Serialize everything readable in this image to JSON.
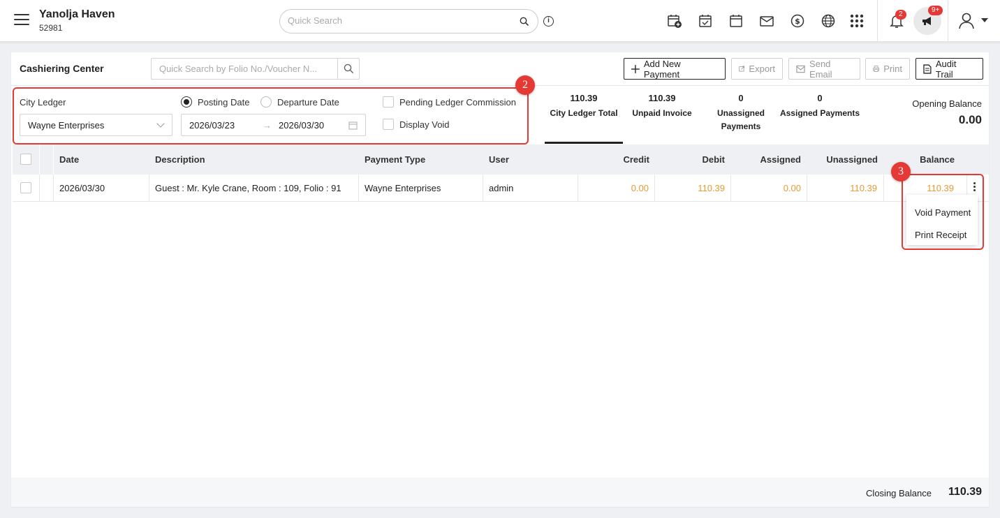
{
  "header": {
    "hotel_name": "Yanolja Haven",
    "hotel_code": "52981",
    "search_placeholder": "Quick Search",
    "notification_count": "2",
    "announcement_count": "9+"
  },
  "page": {
    "title": "Cashiering Center",
    "folio_search_placeholder": "Quick Search by Folio No./Voucher N...",
    "buttons": {
      "add_payment": "Add New Payment",
      "export": "Export",
      "send_email": "Send Email",
      "print": "Print",
      "audit_trail": "Audit Trail"
    }
  },
  "filters": {
    "ledger_label": "City Ledger",
    "ledger_value": "Wayne Enterprises",
    "posting_date_label": "Posting Date",
    "departure_date_label": "Departure Date",
    "date_from": "2026/03/23",
    "date_arrow": "→",
    "date_to": "2026/03/30",
    "pending_commission_label": "Pending Ledger Commission",
    "display_void_label": "Display Void",
    "posting_selected": true
  },
  "summary": {
    "city_ledger_total_value": "110.39",
    "city_ledger_total_label": "City Ledger Total",
    "unpaid_invoice_value": "110.39",
    "unpaid_invoice_label": "Unpaid Invoice",
    "unassigned_value": "0",
    "unassigned_label_1": "Unassigned",
    "unassigned_label_2": "Payments",
    "assigned_value": "0",
    "assigned_label": "Assigned Payments",
    "opening_balance_label": "Opening Balance",
    "opening_balance_value": "0.00"
  },
  "table": {
    "columns": {
      "date": "Date",
      "description": "Description",
      "payment_type": "Payment Type",
      "user": "User",
      "credit": "Credit",
      "debit": "Debit",
      "assigned": "Assigned",
      "unassigned": "Unassigned",
      "balance": "Balance"
    },
    "rows": [
      {
        "date": "2026/03/30",
        "description": "Guest : Mr. Kyle Crane, Room : 109, Folio : 91",
        "payment_type": "Wayne Enterprises",
        "user": "admin",
        "credit": "0.00",
        "debit": "110.39",
        "assigned": "0.00",
        "unassigned": "110.39",
        "balance": "110.39"
      }
    ]
  },
  "row_menu": {
    "void_payment": "Void Payment",
    "print_receipt": "Print Receipt"
  },
  "annotations": {
    "marker_2": "2",
    "marker_3": "3"
  },
  "footer": {
    "closing_balance_label": "Closing Balance",
    "closing_balance_value": "110.39"
  },
  "colors": {
    "accent_red": "#e53935",
    "amount_orange": "#e49b34",
    "header_bg": "#eef0f3"
  }
}
